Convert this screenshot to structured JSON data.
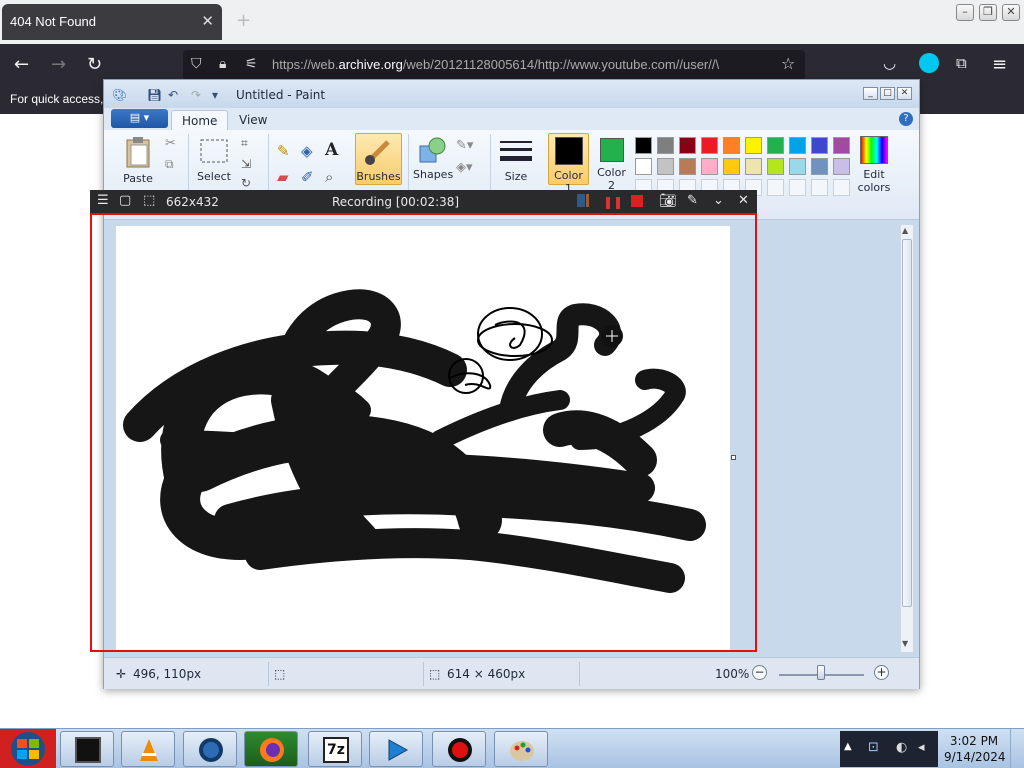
{
  "browser": {
    "tab_title": "404 Not Found",
    "tab_close": "✕",
    "new_tab": "+",
    "url_prefix": "https://web.",
    "url_domain": "archive.org",
    "url_rest": "/web/20121128005614/http://www.youtube.com//user//\\",
    "bookmark_text": "For quick access,",
    "icons": [
      "back-icon",
      "forward-icon",
      "reload-icon",
      "shield-icon",
      "lock-icon",
      "permissions-icon",
      "star-icon",
      "pocket-icon",
      "account-icon",
      "extensions-icon",
      "menu-icon"
    ]
  },
  "paint": {
    "title": "Untitled - Paint",
    "tabs": [
      "Home",
      "View"
    ],
    "help": "?",
    "tools": {
      "paste": "Paste",
      "select": "Select",
      "text_tool": "A",
      "brushes": "Brushes",
      "shapes": "Shapes",
      "size": "Size",
      "color1": "Color\n1",
      "color2": "Color\n2",
      "edit_colors": "Edit\ncolors"
    },
    "color1_hex": "#000000",
    "color2_hex": "#22b14c",
    "palette_row1": [
      "#000000",
      "#7f7f7f",
      "#880015",
      "#ed1c24",
      "#ff7f27",
      "#fff200",
      "#22b14c",
      "#00a2e8",
      "#3f48cc",
      "#a349a4"
    ],
    "palette_row2": [
      "#ffffff",
      "#c3c3c3",
      "#b97a57",
      "#ffaec9",
      "#ffc90e",
      "#efe4b0",
      "#b5e61d",
      "#99d9ea",
      "#7092be",
      "#c8bfe7"
    ],
    "status": {
      "cursor_pos": "496, 110px",
      "canvas_size": "614 × 460px",
      "zoom": "100%",
      "zoom_out": "−",
      "zoom_in": "+"
    }
  },
  "recorder": {
    "size_label": "662x432",
    "status": "Recording [00:02:38]"
  },
  "taskbar": {
    "time": "3:02 PM",
    "date": "9/14/2024",
    "apps": [
      "terminal",
      "vlc-player",
      "network-globe",
      "firefox",
      "7zip",
      "media-player",
      "screen-recorder",
      "paint"
    ]
  }
}
